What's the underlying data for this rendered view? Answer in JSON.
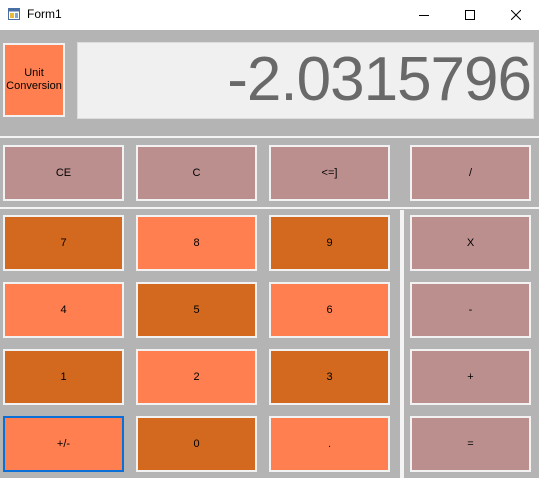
{
  "window": {
    "title": "Form1"
  },
  "unit_conversion": {
    "label": "Unit\nConversion"
  },
  "display": {
    "value": "-2.0315796"
  },
  "buttons": {
    "ce": "CE",
    "c": "C",
    "backspace": "<=]",
    "divide": "/",
    "multiply": "X",
    "subtract": "-",
    "add": "+",
    "equals": "=",
    "seven": "7",
    "eight": "8",
    "nine": "9",
    "four": "4",
    "five": "5",
    "six": "6",
    "one": "1",
    "two": "2",
    "three": "3",
    "negate": "+/-",
    "zero": "0",
    "decimal": "."
  },
  "colors": {
    "operator": "#bc8f8f",
    "digit_dark": "#d2691e",
    "digit_light": "#ff7f50",
    "background": "#b4b4b4",
    "display_text": "#696969"
  }
}
